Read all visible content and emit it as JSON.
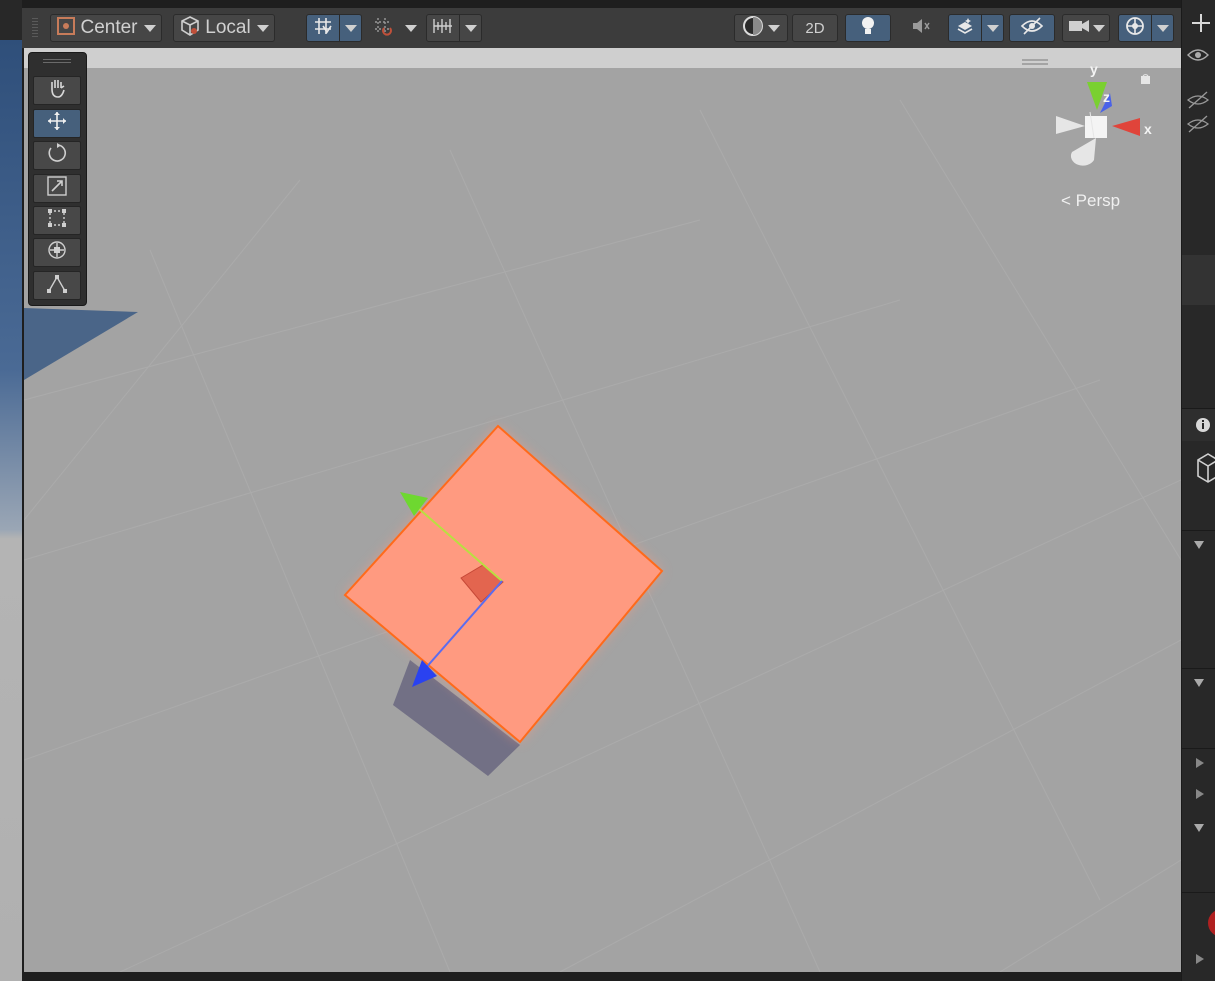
{
  "toolbar": {
    "pivot_mode_label": "Center",
    "pivot_rotation_label": "Local",
    "toggle_2d_label": "2D",
    "icons": [
      "pivot-icon",
      "cube-icon",
      "grid-snap-icon",
      "increment-snap-icon",
      "ruler-icon",
      "render-mode-icon",
      "light-icon",
      "audio-icon",
      "effects-icon",
      "visibility-icon",
      "camera-icon",
      "gizmos-icon"
    ]
  },
  "tools": {
    "items": [
      "hand-tool",
      "move-tool",
      "rotate-tool",
      "scale-tool",
      "rect-tool",
      "transform-tool",
      "custom-tool"
    ],
    "active": "move-tool"
  },
  "gizmo": {
    "axis_y": "y",
    "axis_z": "z",
    "axis_x": "x",
    "projection_label": "Persp"
  },
  "colors": {
    "selection_outline": "#ff6a1a",
    "object_fill": "#ff9a80",
    "axis_x": "#e0443a",
    "axis_y": "#7de03a",
    "axis_z": "#3a5cf0",
    "active_tool": "#46607c"
  }
}
